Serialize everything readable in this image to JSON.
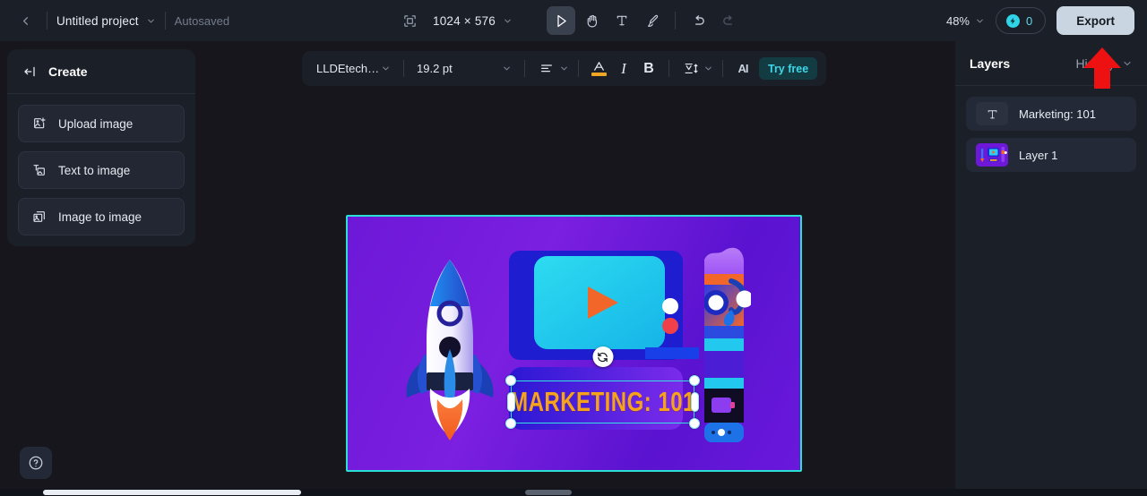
{
  "topbar": {
    "back_icon": "chevron-left-icon",
    "project_name": "Untitled project",
    "project_caret": "chevron-down-icon",
    "autosaved_label": "Autosaved",
    "resize_icon": "resize-canvas-icon",
    "dimensions": "1024 × 576",
    "dimensions_caret": "chevron-down-icon",
    "tools": [
      {
        "name": "select-tool",
        "icon": "cursor-arrow-icon",
        "active": true
      },
      {
        "name": "hand-tool",
        "icon": "hand-icon",
        "active": false
      },
      {
        "name": "text-tool",
        "icon": "text-t-icon",
        "active": false
      },
      {
        "name": "brush-tool",
        "icon": "brush-icon",
        "active": false
      },
      {
        "name": "undo",
        "icon": "undo-arrow-icon",
        "active": false
      },
      {
        "name": "redo",
        "icon": "redo-arrow-icon",
        "active": false,
        "disabled": true
      }
    ],
    "zoom_level": "48%",
    "zoom_caret": "chevron-down-icon",
    "credits_icon": "credit-coin-icon",
    "credits_count": "0",
    "export_label": "Export"
  },
  "text_toolbar": {
    "font_family": "LLDEtech…",
    "font_family_caret": "chevron-down-icon",
    "font_size": "19.2 pt",
    "font_size_caret": "chevron-down-icon",
    "align_icon": "text-align-icon",
    "align_caret": "chevron-down-icon",
    "text_color_icon": "text-color-a-icon",
    "text_color_value": "#f0a525",
    "italic_icon": "italic-i-icon",
    "bold_icon": "bold-b-icon",
    "spacing_icon": "line-spacing-icon",
    "spacing_caret": "chevron-down-icon",
    "ai_icon": "ai-sparkle-icon",
    "try_free_label": "Try free"
  },
  "left_panel": {
    "collapse_icon": "collapse-panel-icon",
    "title": "Create",
    "items": [
      {
        "label": "Upload image",
        "icon": "upload-image-icon"
      },
      {
        "label": "Text to image",
        "icon": "text-to-image-icon"
      },
      {
        "label": "Image to image",
        "icon": "image-to-image-icon"
      }
    ]
  },
  "right_panel": {
    "tab_layers": "Layers",
    "tab_history": "History",
    "tab_caret": "chevron-down-icon",
    "layers": [
      {
        "name": "Marketing: 101",
        "thumb": "text-layer-icon",
        "selected": true
      },
      {
        "name": "Layer 1",
        "thumb": "image-layer-thumbnail",
        "selected": false
      }
    ]
  },
  "canvas": {
    "artboard_border_color": "#2ae0d4",
    "background_color": "#6d18d8",
    "headline_text": "MARKETING: 101",
    "headline_color": "#f7a21b",
    "selection": {
      "rotate_icon": "rotate-handle-icon",
      "handle_color": "#ffffff",
      "outline_color": "#35e0e0"
    },
    "elements": [
      {
        "name": "rocket-illustration"
      },
      {
        "name": "video-player-illustration"
      },
      {
        "name": "play-button-icon"
      },
      {
        "name": "device-column-illustration"
      }
    ]
  },
  "help": {
    "icon": "help-question-icon"
  },
  "annotation": {
    "arrow_icon": "red-up-arrow-annotation",
    "color": "#ee1111"
  },
  "scrollbar": {
    "horizontal_icon": "horizontal-scrollbar"
  }
}
